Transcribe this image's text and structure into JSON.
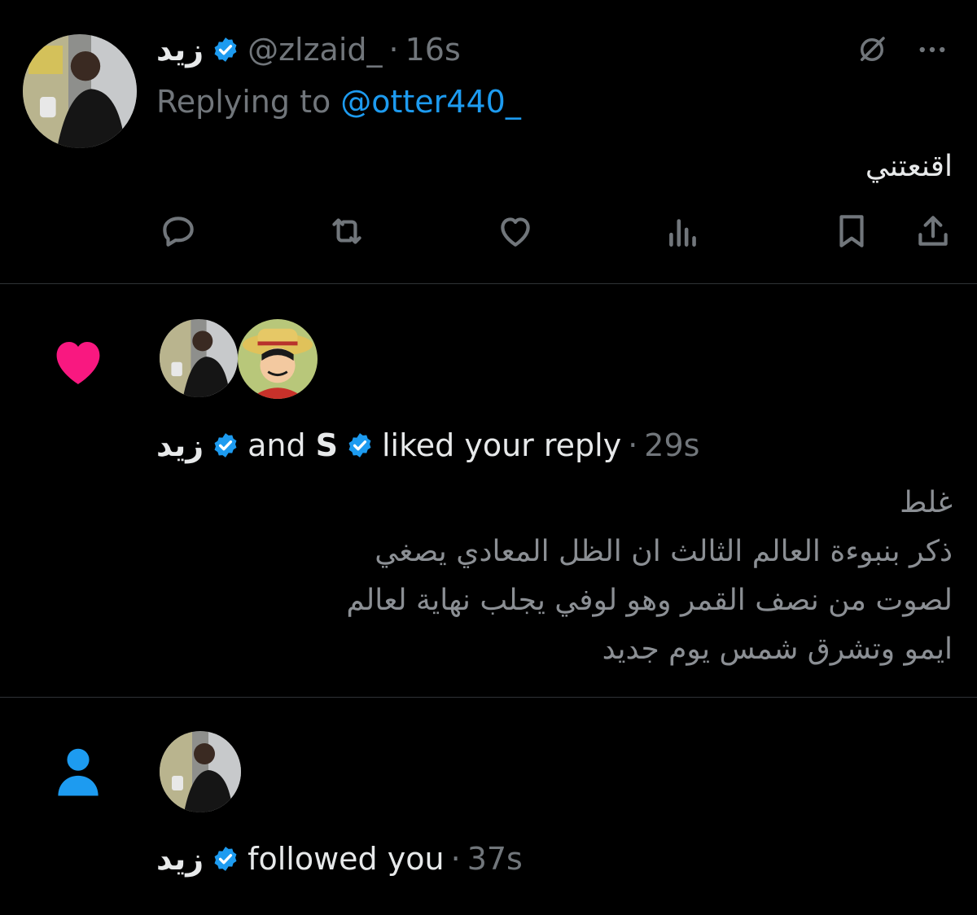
{
  "reply_tweet": {
    "display_name": "زيد",
    "handle": "@zlzaid_",
    "separator": "·",
    "time": "16s",
    "replying_prefix": "Replying to",
    "replying_handle": "@otter440_",
    "text": "اقنعتني"
  },
  "like_notification": {
    "name1": "زيد",
    "and_text": "and",
    "name2": "S",
    "action_text": "liked your reply",
    "separator": "·",
    "time": "29s",
    "lines": [
      "غلط",
      "ذكر بنبوءة العالم الثالث ان الظل المعادي يصغي",
      "لصوت من نصف القمر وهو لوفي يجلب نهاية لعالم",
      "ايمو وتشرق شمس يوم جديد"
    ],
    "heart_color": "#f91880"
  },
  "follow_notification": {
    "name": "زيد",
    "action_text": "followed you",
    "separator": "·",
    "time": "37s",
    "icon_color": "#1d9bf0"
  },
  "icons": {
    "verified": "verified-badge-icon",
    "grok": "grok-icon",
    "more": "more-icon",
    "reply": "reply-icon",
    "retweet": "retweet-icon",
    "like": "heart-icon",
    "views": "views-icon",
    "bookmark": "bookmark-icon",
    "share": "share-icon"
  },
  "colors": {
    "background": "#000000",
    "accent": "#1d9bf0",
    "muted": "#71767b"
  }
}
